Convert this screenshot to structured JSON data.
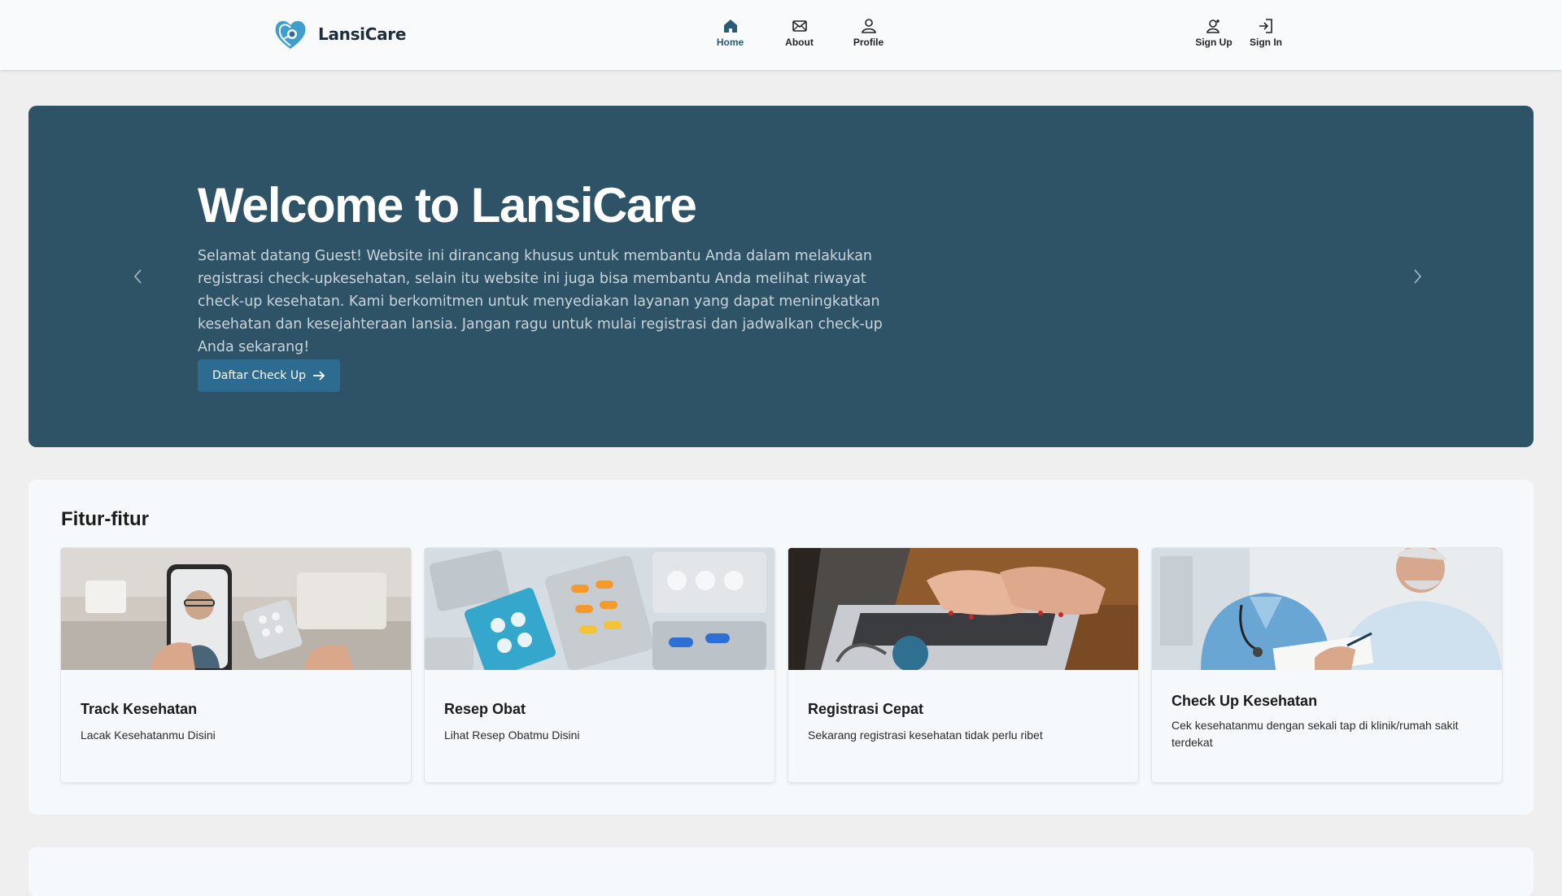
{
  "navbar": {
    "brand": "LansiCare",
    "center": [
      {
        "label": "Home",
        "icon": "home-icon",
        "active": true
      },
      {
        "label": "About",
        "icon": "envelope-icon",
        "active": false
      },
      {
        "label": "Profile",
        "icon": "person-icon",
        "active": false
      }
    ],
    "right": [
      {
        "label": "Sign Up",
        "icon": "person-plus-icon"
      },
      {
        "label": "Sign In",
        "icon": "sign-in-icon"
      }
    ]
  },
  "hero": {
    "title": "Welcome to LansiCare",
    "text": "Selamat datang Guest! Website ini dirancang khusus untuk membantu Anda dalam melakukan registrasi check-upkesehatan, selain itu website ini juga bisa membantu Anda melihat riwayat check-up kesehatan. Kami berkomitmen untuk menyediakan layanan yang dapat meningkatkan kesehatan dan kesejahteraan lansia. Jangan ragu untuk mulai registrasi dan jadwalkan check-up Anda sekarang!",
    "cta_label": "Daftar Check Up"
  },
  "features": {
    "title": "Fitur-fitur",
    "cards": [
      {
        "title": "Track Kesehatan",
        "desc": "Lacak Kesehatanmu Disini",
        "image": "telemedicine-photo"
      },
      {
        "title": "Resep Obat",
        "desc": "Lihat Resep Obatmu Disini",
        "image": "medicine-pills-photo"
      },
      {
        "title": "Registrasi Cepat",
        "desc": "Sekarang registrasi kesehatan tidak perlu ribet",
        "image": "laptop-typing-photo"
      },
      {
        "title": "Check Up Kesehatan",
        "desc": "Cek kesehatanmu dengan sekali tap di klinik/rumah sakit terdekat",
        "image": "doctor-patient-photo"
      }
    ]
  },
  "colors": {
    "hero_bg": "#2e5266",
    "cta_bg": "#2d6b90",
    "nav_active": "#2a5a76",
    "page_bg": "#efefef"
  }
}
